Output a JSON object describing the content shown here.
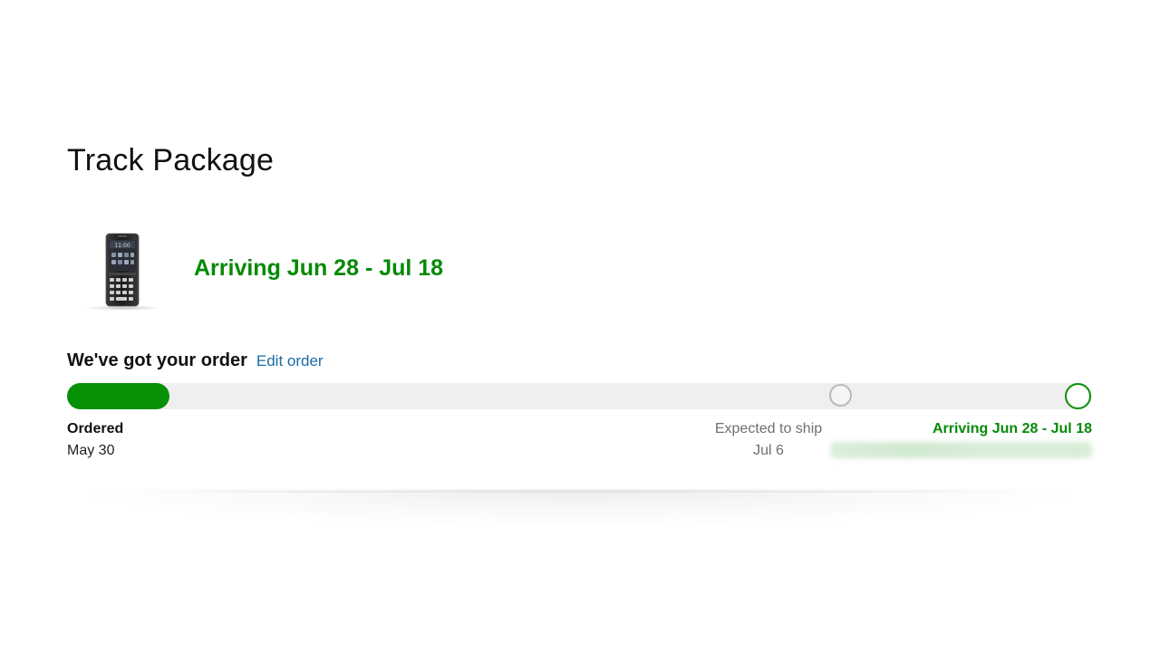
{
  "page": {
    "title": "Track Package"
  },
  "shipment": {
    "headline": "Arriving Jun 28 - Jul 18",
    "product_image_icon": "blackberry-phone-image",
    "status_title": "We've got your order",
    "edit_link_label": "Edit order",
    "progress_fraction": 0.1,
    "accent_color": "#079107",
    "milestones": [
      {
        "title": "Ordered",
        "date": "May 30"
      },
      {
        "title": "Expected to ship",
        "date": "Jul 6"
      },
      {
        "title": "Arriving Jun 28 - Jul 18"
      }
    ]
  }
}
